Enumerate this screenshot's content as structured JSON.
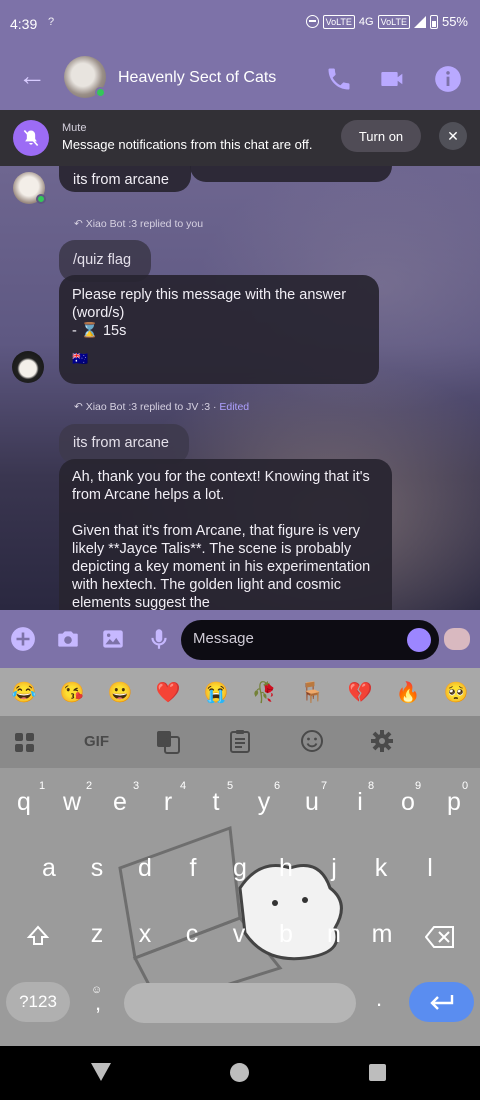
{
  "status": {
    "time": "4:39",
    "signal_text": "?",
    "volte1": "VoLTE",
    "net": "4G",
    "volte2": "VoLTE",
    "battery": "55%"
  },
  "header": {
    "title": "Heavenly Sect of Cats"
  },
  "mute_banner": {
    "title": "Mute",
    "text": "Message notifications from this chat are off.",
    "button": "Turn on"
  },
  "messages": [
    {
      "text": "its from arcane"
    },
    {
      "reply_label": "Xiao Bot :3 replied to you"
    },
    {
      "text": "/quiz flag"
    },
    {
      "line1": "Please reply this message with the answer",
      "line2": "(word/s)",
      "line3": "- ⌛ 15s",
      "flag": "🇦🇺"
    },
    {
      "reply_label": "Xiao Bot :3 replied to JV :3 · ",
      "edited": "Edited"
    },
    {
      "text": "its from arcane"
    },
    {
      "para1": "Ah, thank you for the context! Knowing that it's from Arcane helps a lot.",
      "para2": "Given that it's from Arcane, that figure is very likely **Jayce Talis**. The scene is probably depicting a key moment in his experimentation with hextech. The golden light and cosmic elements suggest the"
    }
  ],
  "composer": {
    "placeholder": "Message"
  },
  "keyboard": {
    "emojis": [
      "😂",
      "😘",
      "😀",
      "❤️",
      "😭",
      "🥀",
      "🪑",
      "💔",
      "🔥",
      "🥺"
    ],
    "gif": "GIF",
    "row1": [
      "q",
      "w",
      "e",
      "r",
      "t",
      "y",
      "u",
      "i",
      "o",
      "p"
    ],
    "row1_hints": [
      "1",
      "2",
      "3",
      "4",
      "5",
      "6",
      "7",
      "8",
      "9",
      "0"
    ],
    "row2": [
      "a",
      "s",
      "d",
      "f",
      "g",
      "h",
      "j",
      "k",
      "l"
    ],
    "row3": [
      "z",
      "x",
      "c",
      "v",
      "b",
      "n",
      "m"
    ],
    "sym": "?123",
    "comma": ",",
    "period": "."
  }
}
